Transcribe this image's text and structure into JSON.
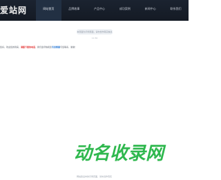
{
  "header": {
    "logo_text": "爱站网",
    "nav": [
      {
        "label": "网站首页",
        "active": true
      },
      {
        "label": "品牌故事",
        "active": false
      },
      {
        "label": "产品中心",
        "active": false
      },
      {
        "label": "成功案例",
        "active": false
      },
      {
        "label": "新闻中心",
        "active": false
      },
      {
        "label": "联系我们",
        "active": false
      }
    ]
  },
  "notice": {
    "badge": "本页面为示例页面，请勿当作真实信息",
    "time": "11:56"
  },
  "message": {
    "prefix": "您好，欢迎您的到来，",
    "highlight_red": "请留下您的电话",
    "middle": "，我们会尽快和您",
    "highlight_blue": "专员客服",
    "suffix": "与您联系，谢谢！"
  },
  "brand_logo": {
    "text": "动名收录网",
    "color_primary": "#24b24a",
    "color_secondary": "#2fb84e"
  },
  "footer": {
    "text": "网站建设中的示例页面，请勿当作真实"
  }
}
